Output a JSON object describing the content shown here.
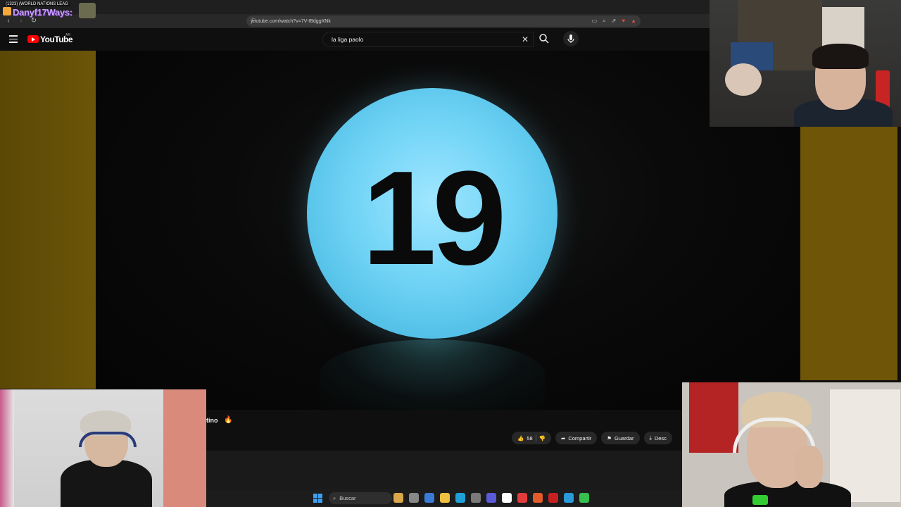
{
  "browser": {
    "tab_title": "(1323) (WORLD NATIONS LEAG",
    "url": "youtube.com/watch?v=7V-IBdggXNk"
  },
  "overlay": {
    "streamer_name": "Danyf17Ways:"
  },
  "youtube": {
    "logo_text": "YouTube",
    "region": "AR",
    "search_value": "la liga paolo"
  },
  "video": {
    "number": "19",
    "ball_color": "#6fd3f5"
  },
  "below_video": {
    "channel_name_partial": "tino",
    "likes": "58",
    "share_label": "Compartir",
    "save_label": "Guardar",
    "download_label": "Desc"
  },
  "taskbar": {
    "search_label": "Buscar",
    "icon_colors": [
      "#d8a84a",
      "#888888",
      "#3a7bd5",
      "#f0c040",
      "#1fa0d8",
      "#7a7a7a",
      "#5a5ad8",
      "#ffffff",
      "#e23b3b",
      "#e25b2b",
      "#c82020",
      "#2a9ad8",
      "#35c050"
    ]
  }
}
